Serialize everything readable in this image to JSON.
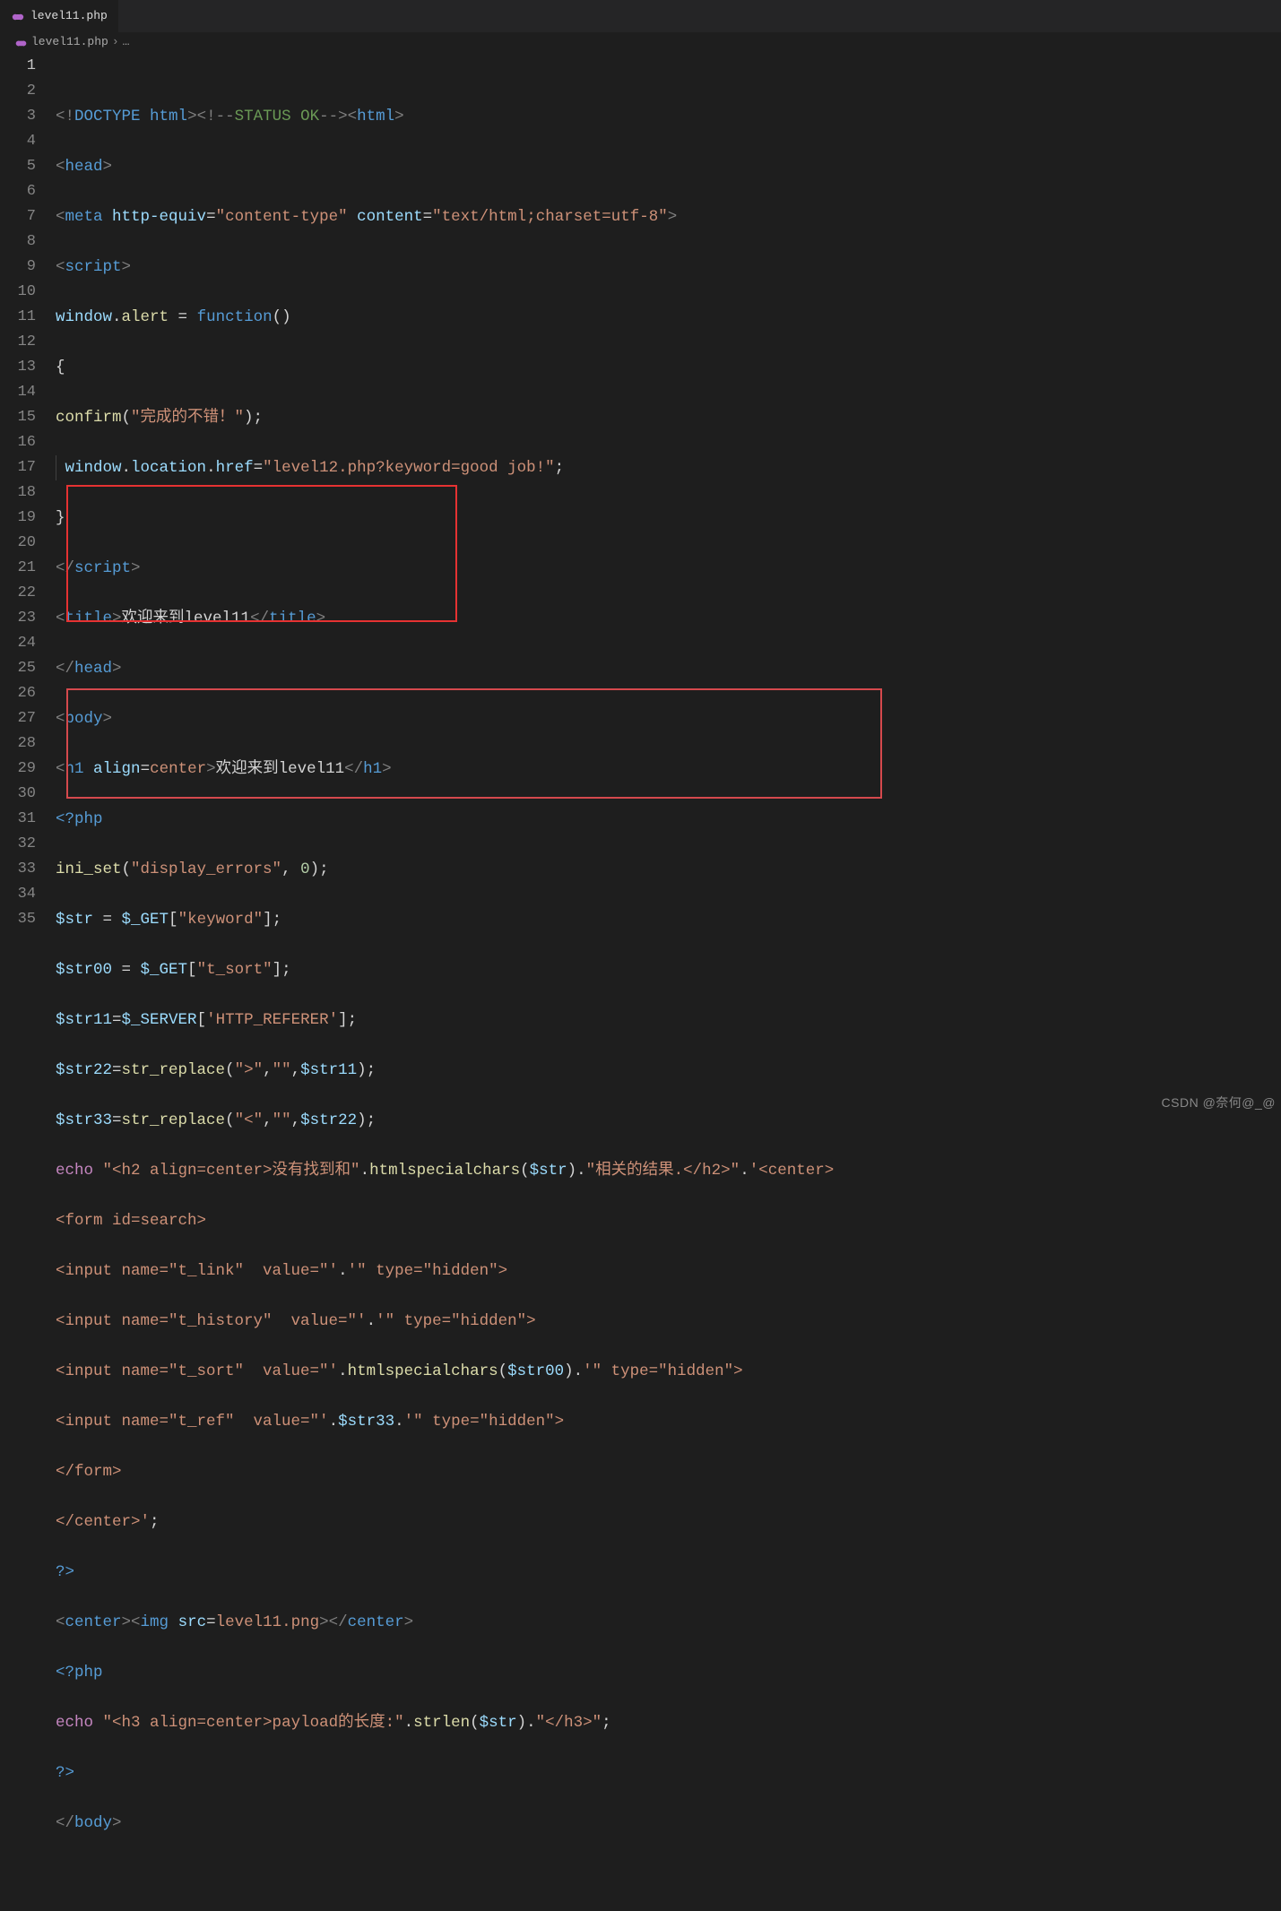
{
  "tab": {
    "filename": "level11.php"
  },
  "breadcrumb": {
    "file": "level11.php",
    "more": "…"
  },
  "gutter": {
    "lines": [
      "1",
      "2",
      "3",
      "4",
      "5",
      "6",
      "7",
      "8",
      "9",
      "10",
      "11",
      "12",
      "13",
      "14",
      "15",
      "16",
      "17",
      "18",
      "19",
      "20",
      "21",
      "22",
      "23",
      "24",
      "25",
      "26",
      "27",
      "28",
      "29",
      "30",
      "31",
      "32",
      "33",
      "34",
      "35"
    ],
    "activeLine": 1
  },
  "code": {
    "l1": {
      "a": "<!",
      "b": "DOCTYPE",
      "c": " ",
      "d": "html",
      "e": "><!--",
      "f": "STATUS OK",
      "g": "--><",
      "h": "html",
      "i": ">"
    },
    "l2": {
      "a": "<",
      "b": "head",
      "c": ">"
    },
    "l3": {
      "a": "<",
      "b": "meta",
      "c": " ",
      "d": "http-equiv",
      "e": "=",
      "f": "\"content-type\"",
      "g": " ",
      "h": "content",
      "i": "=",
      "j": "\"text/html;charset=utf-8\"",
      "k": ">"
    },
    "l4": {
      "a": "<",
      "b": "script",
      "c": ">"
    },
    "l5": {
      "a": "window",
      "b": ".",
      "c": "alert",
      "d": " = ",
      "e": "function",
      "f": "()"
    },
    "l6": {
      "a": "{"
    },
    "l7": {
      "a": "confirm",
      "b": "(",
      "c": "\"完成的不错！\"",
      "d": ");"
    },
    "l8": {
      "a": " ",
      "b": "window",
      "c": ".",
      "d": "location",
      "e": ".",
      "f": "href",
      "g": "=",
      "h": "\"level12.php?keyword=good job!\"",
      "i": ";"
    },
    "l9": {
      "a": "}"
    },
    "l10": {
      "a": "</",
      "b": "script",
      "c": ">"
    },
    "l11": {
      "a": "<",
      "b": "title",
      "c": ">",
      "d": "欢迎来到level11",
      "e": "</",
      "f": "title",
      "g": ">"
    },
    "l12": {
      "a": "</",
      "b": "head",
      "c": ">"
    },
    "l13": {
      "a": "<",
      "b": "body",
      "c": ">"
    },
    "l14": {
      "a": "<",
      "b": "h1",
      "c": " ",
      "d": "align",
      "e": "=",
      "f": "center",
      "g": ">",
      "h": "欢迎来到level11",
      "i": "</",
      "j": "h1",
      "k": ">"
    },
    "l15": {
      "a": "<?php"
    },
    "l16": {
      "a": "ini_set",
      "b": "(",
      "c": "\"display_errors\"",
      "d": ", ",
      "e": "0",
      "f": ");"
    },
    "l17": {
      "a": "$str",
      "b": " = ",
      "c": "$_GET",
      "d": "[",
      "e": "\"keyword\"",
      "f": "];"
    },
    "l18": {
      "a": "$str00",
      "b": " = ",
      "c": "$_GET",
      "d": "[",
      "e": "\"t_sort\"",
      "f": "];"
    },
    "l19": {
      "a": "$str11",
      "b": "=",
      "c": "$_SERVER",
      "d": "[",
      "e": "'HTTP_REFERER'",
      "f": "];"
    },
    "l20": {
      "a": "$str22",
      "b": "=",
      "c": "str_replace",
      "d": "(",
      "e": "\">\"",
      "f": ",",
      "g": "\"\"",
      "h": ",",
      "i": "$str11",
      "j": ");"
    },
    "l21": {
      "a": "$str33",
      "b": "=",
      "c": "str_replace",
      "d": "(",
      "e": "\"<\"",
      "f": ",",
      "g": "\"\"",
      "h": ",",
      "i": "$str22",
      "j": ");"
    },
    "l22": {
      "a": "echo",
      "b": " ",
      "c": "\"<h2 align=center>没有找到和\"",
      "d": ".",
      "e": "htmlspecialchars",
      "f": "(",
      "g": "$str",
      "h": ").",
      "i": "\"相关的结果.</h2>\"",
      "j": ".",
      "k": "'<center>"
    },
    "l23": {
      "a": "<form id=search>"
    },
    "l24": {
      "a": "<input name=\"t_link\"  value=\"'",
      "b": ".",
      "c": "'\" type=\"hidden\">"
    },
    "l25": {
      "a": "<input name=\"t_history\"  value=\"'",
      "b": ".",
      "c": "'\" type=\"hidden\">"
    },
    "l26": {
      "a": "<input name=\"t_sort\"  value=\"'",
      "b": ".",
      "c": "htmlspecialchars",
      "d": "(",
      "e": "$str00",
      "f": ").",
      "g": "'\" type=\"hidden\">"
    },
    "l27": {
      "a": "<input name=\"t_ref\"  value=\"'",
      "b": ".",
      "c": "$str33",
      "d": ".",
      "e": "'\" type=\"hidden\">"
    },
    "l28": {
      "a": "</form>"
    },
    "l29": {
      "a": "</center>'",
      "b": ";"
    },
    "l30": {
      "a": "?>"
    },
    "l31": {
      "a": "<",
      "b": "center",
      "c": "><",
      "d": "img",
      "e": " ",
      "f": "src",
      "g": "=",
      "h": "level11.png",
      "i": "></",
      "j": "center",
      "k": ">"
    },
    "l32": {
      "a": "<?php"
    },
    "l33": {
      "a": "echo",
      "b": " ",
      "c": "\"<h3 align=center>payload的长度:\"",
      "d": ".",
      "e": "strlen",
      "f": "(",
      "g": "$str",
      "h": ").",
      "i": "\"</h3>\"",
      "j": ";"
    },
    "l34": {
      "a": "?>"
    },
    "l35": {
      "a": "</",
      "b": "body",
      "c": ">"
    }
  },
  "watermark": "CSDN @奈何@_@"
}
